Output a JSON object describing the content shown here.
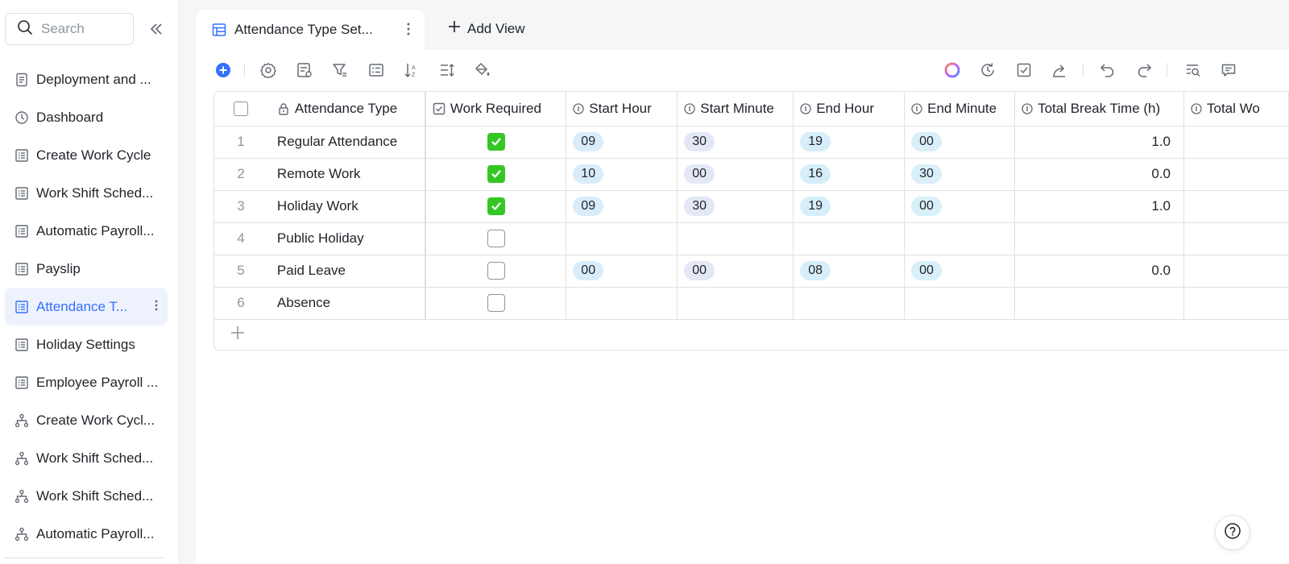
{
  "sidebar": {
    "search_placeholder": "Search",
    "items": [
      {
        "label": "Deployment and ...",
        "icon": "document-icon"
      },
      {
        "label": "Dashboard",
        "icon": "dashboard-icon"
      },
      {
        "label": "Create Work Cycle",
        "icon": "table-icon"
      },
      {
        "label": "Work Shift Sched...",
        "icon": "table-icon"
      },
      {
        "label": "Automatic Payroll...",
        "icon": "table-icon"
      },
      {
        "label": "Payslip",
        "icon": "table-icon"
      },
      {
        "label": "Attendance T...",
        "icon": "table-icon",
        "active": true
      },
      {
        "label": "Holiday Settings",
        "icon": "table-icon"
      },
      {
        "label": "Employee Payroll ...",
        "icon": "table-icon"
      },
      {
        "label": "Create Work Cycl...",
        "icon": "workflow-icon"
      },
      {
        "label": "Work Shift Sched...",
        "icon": "workflow-icon"
      },
      {
        "label": "Work Shift Sched...",
        "icon": "workflow-icon"
      },
      {
        "label": "Automatic Payroll...",
        "icon": "workflow-icon"
      }
    ]
  },
  "tabs": {
    "active_label": "Attendance Type Set...",
    "add_view_label": "Add View"
  },
  "table": {
    "columns": {
      "attendance_type": "Attendance Type",
      "work_required": "Work Required",
      "start_hour": "Start Hour",
      "start_minute": "Start Minute",
      "end_hour": "End Hour",
      "end_minute": "End Minute",
      "total_break": "Total Break Time (h)",
      "total_wo": "Total Wo"
    },
    "rows": [
      {
        "idx": "1",
        "name": "Regular Attendance",
        "work_required": true,
        "start_hour": "09",
        "start_minute": "30",
        "end_hour": "19",
        "end_minute": "00",
        "total_break": "1.0"
      },
      {
        "idx": "2",
        "name": "Remote Work",
        "work_required": true,
        "start_hour": "10",
        "start_minute": "00",
        "end_hour": "16",
        "end_minute": "30",
        "total_break": "0.0"
      },
      {
        "idx": "3",
        "name": "Holiday Work",
        "work_required": true,
        "start_hour": "09",
        "start_minute": "30",
        "end_hour": "19",
        "end_minute": "00",
        "total_break": "1.0"
      },
      {
        "idx": "4",
        "name": "Public Holiday",
        "work_required": false,
        "start_hour": "",
        "start_minute": "",
        "end_hour": "",
        "end_minute": "",
        "total_break": ""
      },
      {
        "idx": "5",
        "name": "Paid Leave",
        "work_required": false,
        "start_hour": "00",
        "start_minute": "00",
        "end_hour": "08",
        "end_minute": "00",
        "total_break": "0.0"
      },
      {
        "idx": "6",
        "name": "Absence",
        "work_required": false,
        "start_hour": "",
        "start_minute": "",
        "end_hour": "",
        "end_minute": "",
        "total_break": ""
      }
    ]
  },
  "colors": {
    "accent": "#3370ff",
    "checkbox_on": "#34c724",
    "active_nav_bg": "#eef2fd"
  }
}
